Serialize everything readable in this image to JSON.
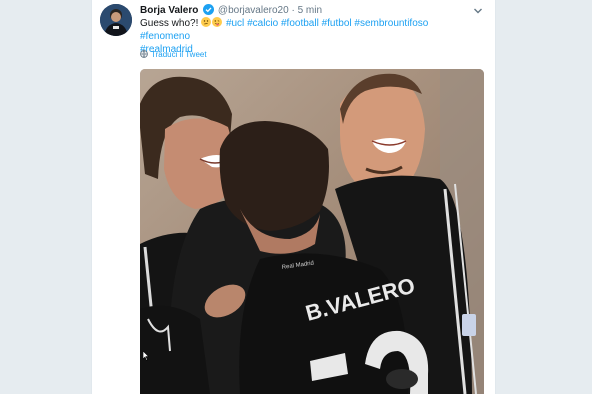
{
  "tweet": {
    "author_name": "Borja Valero",
    "handle": "@borjavalero20",
    "separator": "·",
    "time": "5 min",
    "text_lead": "Guess who?!",
    "hashtags": [
      "#ucl",
      "#calcio",
      "#football",
      "#futbol",
      "#sembrountifoso",
      "#fenomeno",
      "#realmadrid"
    ],
    "translate_label": "Traduci il Tweet",
    "jersey_text": "B.VALERO",
    "jersey_sponsor": "Real Madrid"
  },
  "colors": {
    "link": "#1da1f2",
    "text": "#14171a",
    "muted": "#657786",
    "background": "#e6ecf0"
  },
  "icons": [
    "verified-badge-icon",
    "chevron-down-icon",
    "globe-icon",
    "emoji-thinking-icon",
    "emoji-tongue-icon"
  ]
}
